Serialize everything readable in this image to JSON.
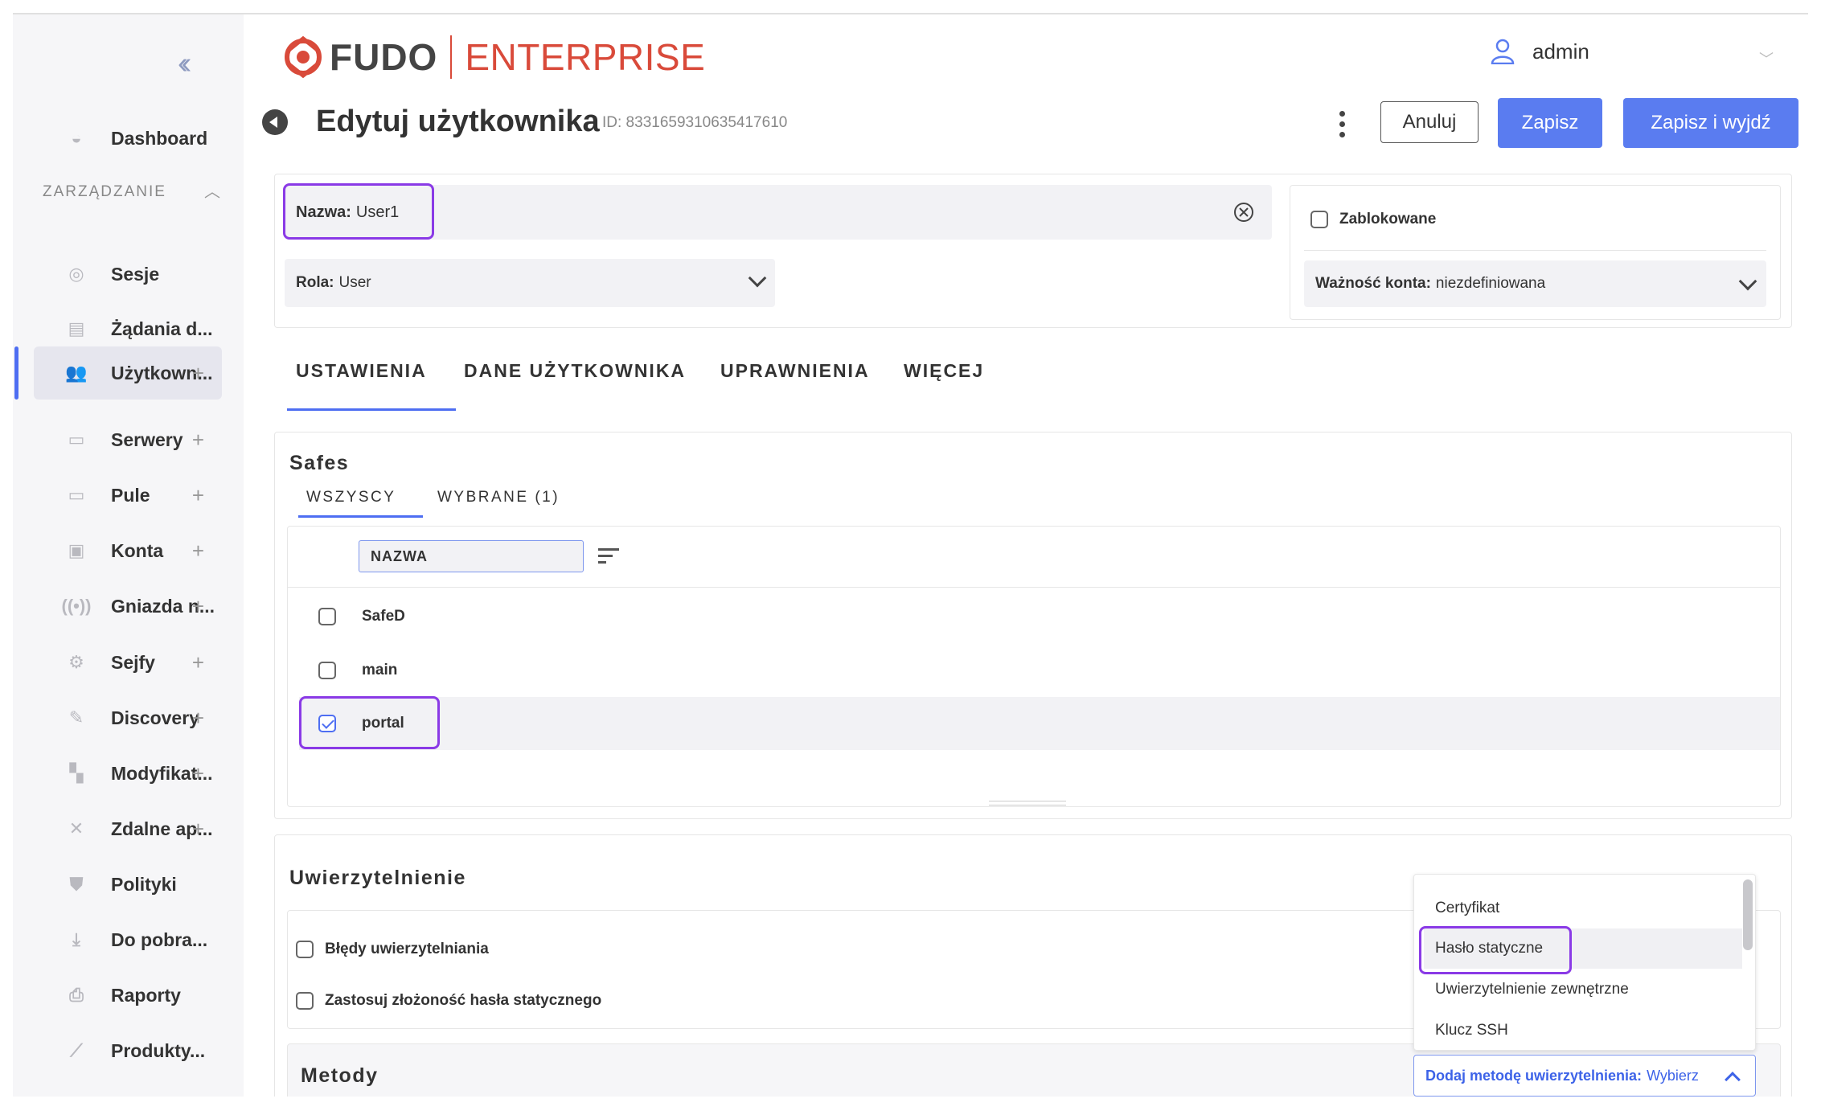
{
  "sidebar": {
    "dashboard": "Dashboard",
    "section": "ZARZĄDZANIE",
    "items": [
      {
        "label": "Sesje",
        "plus": ""
      },
      {
        "label": "Żądania d...",
        "plus": ""
      },
      {
        "label": "Użytkown...",
        "plus": "+"
      },
      {
        "label": "Serwery",
        "plus": "+"
      },
      {
        "label": "Pule",
        "plus": "+"
      },
      {
        "label": "Konta",
        "plus": "+"
      },
      {
        "label": "Gniazda n...",
        "plus": "+"
      },
      {
        "label": "Sejfy",
        "plus": "+"
      },
      {
        "label": "Discovery",
        "plus": "+"
      },
      {
        "label": "Modyfikat...",
        "plus": "+"
      },
      {
        "label": "Zdalne ap...",
        "plus": "+"
      },
      {
        "label": "Polityki",
        "plus": ""
      },
      {
        "label": "Do pobra...",
        "plus": ""
      },
      {
        "label": "Raporty",
        "plus": ""
      },
      {
        "label": "Produkty...",
        "plus": ""
      }
    ]
  },
  "header": {
    "logo_main": "FUDO",
    "logo_sub": "ENTERPRISE",
    "user": "admin",
    "title": "Edytuj użytkownika",
    "id_text": "ID: 8331659310635417610",
    "cancel": "Anuluj",
    "save": "Zapisz",
    "save_exit": "Zapisz i wyjdź"
  },
  "form": {
    "name_label": "Nazwa:",
    "name_value": "User1",
    "role_label": "Rola:",
    "role_value": "User",
    "blocked_label": "Zablokowane",
    "validity_label": "Ważność konta:",
    "validity_value": "niezdefiniowana"
  },
  "tabs": [
    "USTAWIENIA",
    "DANE UŻYTKOWNIKA",
    "UPRAWNIENIA",
    "WIĘCEJ"
  ],
  "safes": {
    "title": "Safes",
    "subtabs": [
      "WSZYSCY",
      "WYBRANE (1)"
    ],
    "search_label": "NAZWA",
    "rows": [
      {
        "name": "SafeD",
        "checked": false
      },
      {
        "name": "main",
        "checked": false
      },
      {
        "name": "portal",
        "checked": true
      }
    ]
  },
  "auth": {
    "title": "Uwierzytelnienie",
    "opt1": "Błędy uwierzytelniania",
    "opt2": "Zastosuj złożoność hasła statycznego",
    "methods_title": "Metody",
    "dropdown_items": [
      "Certyfikat",
      "Hasło statyczne",
      "Uwierzytelnienie zewnętrzne",
      "Klucz SSH"
    ],
    "add_method_label": "Dodaj metodę uwierzytelnienia:",
    "add_method_value": "Wybierz"
  }
}
